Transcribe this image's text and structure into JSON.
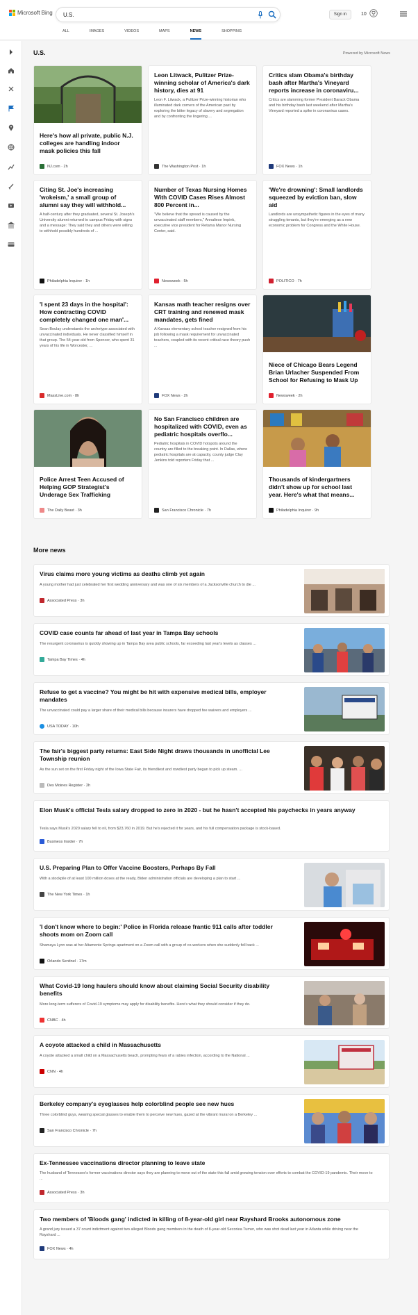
{
  "header": {
    "logo_text": "Microsoft Bing",
    "search_value": "U.S.",
    "sign_in": "Sign in",
    "points": "10",
    "tabs": [
      "ALL",
      "IMAGES",
      "VIDEOS",
      "MAPS",
      "NEWS",
      "SHOPPING"
    ]
  },
  "main": {
    "section_title": "U.S.",
    "powered": "Powered by Microsoft News",
    "more_news": "More news"
  },
  "cards": [
    {
      "title": "Here's how all private, public N.J. colleges are handling indoor mask policies this fall",
      "snippet": "",
      "source": "NJ.com",
      "time": "· 2h",
      "color": "#2a6f36"
    },
    {
      "title": "Leon Litwack, Pulitzer Prize-winning scholar of America's dark history, dies at 91",
      "snippet": "Leon F. Litwack, a Pulitzer Prize-winning historian who illuminated dark corners of the American past by exploring the bitter legacy of slavery and segregation and by confronting the lingering ...",
      "source": "The Washington Post",
      "time": "· 1h",
      "color": "#333"
    },
    {
      "title": "Critics slam Obama's birthday bash after Martha's Vineyard reports increase in coronaviru...",
      "snippet": "Critics are slamming former President Barack Obama and his birthday bash last weekend after Martha's Vineyard reported a spike in coronavirus cases.",
      "source": "FOX News",
      "time": "· 1h",
      "color": "#1f3a7a"
    },
    {
      "title": "Citing St. Joe's increasing 'wokeism,' a small group of alumni say they will withhold...",
      "snippet": "A half-century after they graduated, several St. Joseph's University alumni returned to campus Friday with signs and a message: They said they and others were willing to withhold possibly hundreds of ...",
      "source": "Philadelphia Inquirer",
      "time": "· 1h",
      "color": "#111"
    },
    {
      "title": "Number of Texas Nursing Homes With COVID Cases Rises Almost 800 Percent in...",
      "snippet": "\"We believe that the spread is caused by the unvaccinated staff members,\" Annaliese Impink, executive vice president for Retama Manor Nursing Center, said.",
      "source": "Newsweek",
      "time": "· 5h",
      "color": "#e0202e"
    },
    {
      "title": "'We're drowning': Small landlords squeezed by eviction ban, slow aid",
      "snippet": "Landlords are unsympathetic figures in the eyes of many struggling tenants, but they're emerging as a new economic problem for Congress and the White House.",
      "source": "POLITICO",
      "time": "· 7h",
      "color": "#d01f2f"
    },
    {
      "title": "'I spent 23 days in the hospital': How contracting COVID completely changed one man'...",
      "snippet": "Sean Boulay understands the archetype associated with unvaccinated individuals. He never classified himself in that group. The 54-year-old from Spencer, who spent 31 years of his life in Worcester, ...",
      "source": "MassLive.com",
      "time": "· 8h",
      "color": "#d92b2b"
    },
    {
      "title": "Kansas math teacher resigns over CRT training and renewed mask mandates, gets fined",
      "snippet": "A Kansas elementary school teacher resigned from his job following a mask requirement for unvaccinated teachers, coupled with its recent critical race theory push ...",
      "source": "FOX News",
      "time": "· 2h",
      "color": "#1f3a7a"
    },
    {
      "title": "Niece of Chicago Bears Legend Brian Urlacher Suspended From School for Refusing to Mask Up",
      "snippet": "",
      "source": "Newsweek",
      "time": "· 2h",
      "color": "#e0202e"
    },
    {
      "title": "Police Arrest Teen Accused of Helping GOP Strategist's Underage Sex Trafficking",
      "snippet": "",
      "source": "The Daily Beast",
      "time": "· 3h",
      "color": "#e88"
    },
    {
      "title": "No San Francisco children are hospitalized with COVID, even as pediatric hospitals overflo...",
      "snippet": "Pediatric hospitals in COVID hotspots around the country are filled to the breaking point. In Dallas, where pediatric hospitals are at capacity, county judge Clay Jenkins told reporters Friday that ...",
      "source": "San Francisco Chronicle",
      "time": "· 7h",
      "color": "#222"
    },
    {
      "title": "Thousands of kindergartners didn't show up for school last year. Here's what that means...",
      "snippet": "",
      "source": "Philadelphia Inquirer",
      "time": "· 9h",
      "color": "#111"
    }
  ],
  "rows": [
    {
      "title": "Virus claims more young victims as deaths climb yet again",
      "snippet": "A young mother had just celebrated her first wedding anniversary and was one of six members of a Jacksonville church to die ...",
      "source": "Associated Press",
      "time": "· 3h",
      "color": "#c0272d"
    },
    {
      "title": "COVID case counts far ahead of last year in Tampa Bay schools",
      "snippet": "The resurgent coronavirus is quickly showing up in Tampa Bay area public schools, far exceeding last year's levels as classes ...",
      "source": "Tampa Bay Times",
      "time": "· 4h",
      "color": "#3a9"
    },
    {
      "title": "Refuse to get a vaccine? You might be hit with expensive medical bills, employer mandates",
      "snippet": "The unvaccinated could pay a larger share of their medical bills because insurers have dropped fee waivers and employers ...",
      "source": "USA TODAY",
      "time": "· 10h",
      "color": "#1a8fe3"
    },
    {
      "title": "The fair's biggest party returns: East Side Night draws thousands in unofficial Lee Township reunion",
      "snippet": "As the sun set on the first Friday night of the Iowa State Fair, its friendliest and rowdiest party began to pick up steam. ...",
      "source": "Des Moines Register",
      "time": "· 2h",
      "color": "#bbb"
    },
    {
      "title": "Elon Musk's official Tesla salary dropped to zero in 2020 - but he hasn't accepted his paychecks in years anyway",
      "snippet": "Tesla says Musk's 2020 salary fell to nil, from $23,760 in 2019. But he's rejected it for years, and his full compensation package is stock-based.",
      "source": "Business Insider",
      "time": "· 7h",
      "color": "#2a5bd7"
    },
    {
      "title": "U.S. Preparing Plan to Offer Vaccine Boosters, Perhaps By Fall",
      "snippet": "With a stockpile of at least 100 million doses at the ready, Biden administration officials are developing a plan to start ...",
      "source": "The New York Times",
      "time": "· 1h",
      "color": "#444"
    },
    {
      "title": "'I don't know where to begin:' Police in Florida release frantic 911 calls after toddler shoots mom on Zoom call",
      "snippet": "Shamaya Lynn was at her Altamonte Springs apartment on a Zoom call with a group of co-workers when she suddenly fell back ...",
      "source": "Orlando Sentinel",
      "time": "· 17m",
      "color": "#111"
    },
    {
      "title": "What Covid-19 long haulers should know about claiming Social Security disability benefits",
      "snippet": "More long-term sufferers of Covid-19 symptoms may apply for disability benefits. Here's what they should consider if they do.",
      "source": "CNBC",
      "time": "· 4h",
      "color": "#e33"
    },
    {
      "title": "A coyote attacked a child in Massachusetts",
      "snippet": "A coyote attacked a small child on a Massachusetts beach, prompting fears of a rabies infection, according to the National ...",
      "source": "CNN",
      "time": "· 4h",
      "color": "#cc0000"
    },
    {
      "title": "Berkeley company's eyeglasses help colorblind people see new hues",
      "snippet": "Three colorblind guys, wearing special glasses to enable them to perceive new hues, gazed at the vibrant mural on a Berkeley ...",
      "source": "San Francisco Chronicle",
      "time": "· 7h",
      "color": "#222"
    },
    {
      "title": "Ex-Tennessee vaccinations director planning to leave state",
      "snippet": "The husband of Tennessee's former vaccinations director says they are planning to move out of the state this fall amid growing tension over efforts to combat the COVID-19 pandemic. Their move to ...",
      "source": "Associated Press",
      "time": "· 3h",
      "color": "#c0272d"
    },
    {
      "title": "Two members of 'Bloods gang' indicted in killing of 8-year-old girl near Rayshard Brooks autonomous zone",
      "snippet": "A grand jury issued a 37 count indictment against two alleged Bloods gang members in the death of 8-year-old Secoriea Turner, who was shot dead last year in Atlanta while driving near the Rayshard ...",
      "source": "FOX News",
      "time": "· 4h",
      "color": "#1f3a7a"
    }
  ]
}
